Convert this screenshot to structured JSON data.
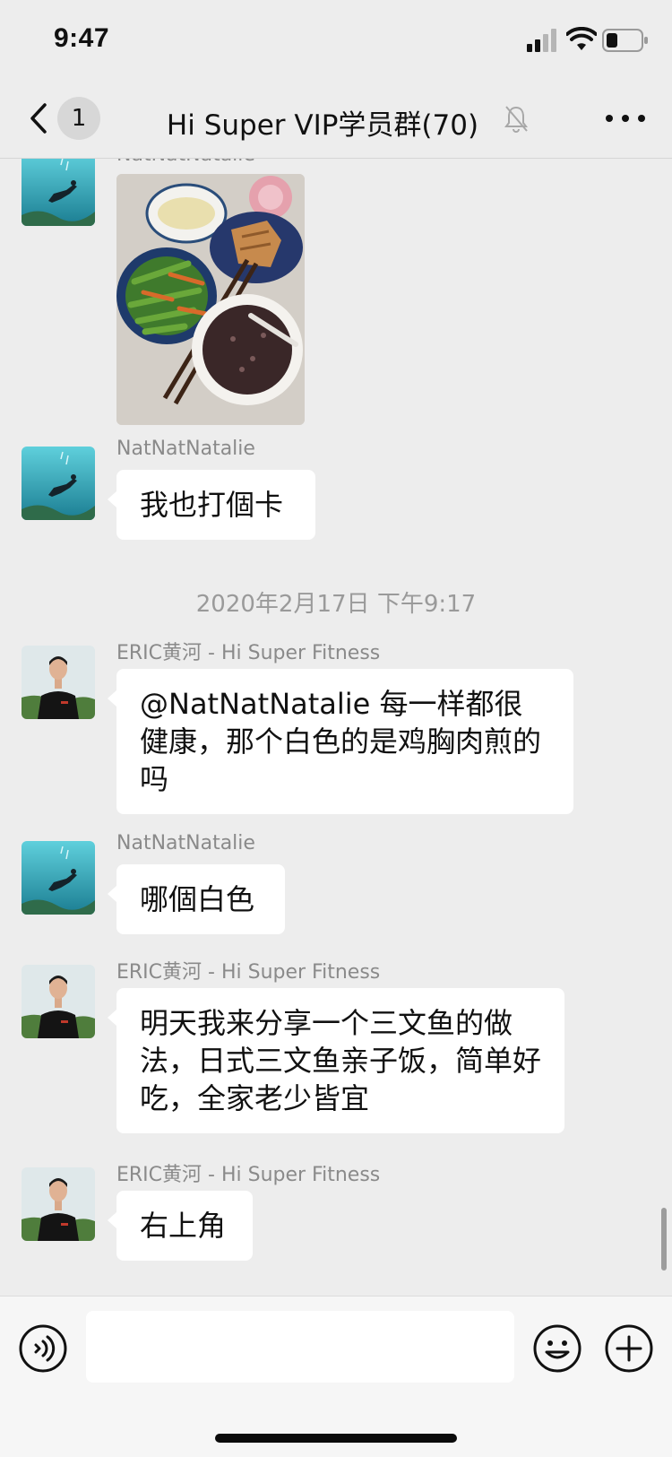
{
  "status_bar": {
    "time": "9:47"
  },
  "header": {
    "back_count": "1",
    "title": "Hi Super VIP学员群(70)",
    "icons": {
      "back": "chevron-left-icon",
      "mute": "bell-muted-icon",
      "more": "more-dots-icon"
    }
  },
  "messages": [
    {
      "type": "image",
      "sender": "NatNatNatalie",
      "avatar": "diver-avatar",
      "image_alt": "home-cooked meal photo"
    },
    {
      "type": "text",
      "sender": "NatNatNatalie",
      "avatar": "diver-avatar",
      "text": "我也打個卡"
    },
    {
      "type": "timestamp",
      "text": "2020年2月17日 下午9:17"
    },
    {
      "type": "text",
      "sender": "ERIC黄河 - Hi Super Fitness",
      "avatar": "coach-avatar",
      "text": "@NatNatNatalie 每一样都很健康，那个白色的是鸡胸肉煎的吗"
    },
    {
      "type": "text",
      "sender": "NatNatNatalie",
      "avatar": "diver-avatar",
      "text": "哪個白色"
    },
    {
      "type": "text",
      "sender": "ERIC黄河 - Hi Super Fitness",
      "avatar": "coach-avatar",
      "text": "明天我来分享一个三文鱼的做法，日式三文鱼亲子饭，简单好吃，全家老少皆宜"
    },
    {
      "type": "text",
      "sender": "ERIC黄河 - Hi Super Fitness",
      "avatar": "coach-avatar",
      "text": "右上角"
    }
  ],
  "input_bar": {
    "value": "",
    "icons": {
      "voice": "voice-icon",
      "emoji": "emoji-icon",
      "plus": "plus-icon"
    }
  },
  "colors": {
    "background": "#ededed",
    "bubble": "#ffffff",
    "sender_name": "#8a8a8a",
    "timestamp": "#9a9a9a"
  }
}
